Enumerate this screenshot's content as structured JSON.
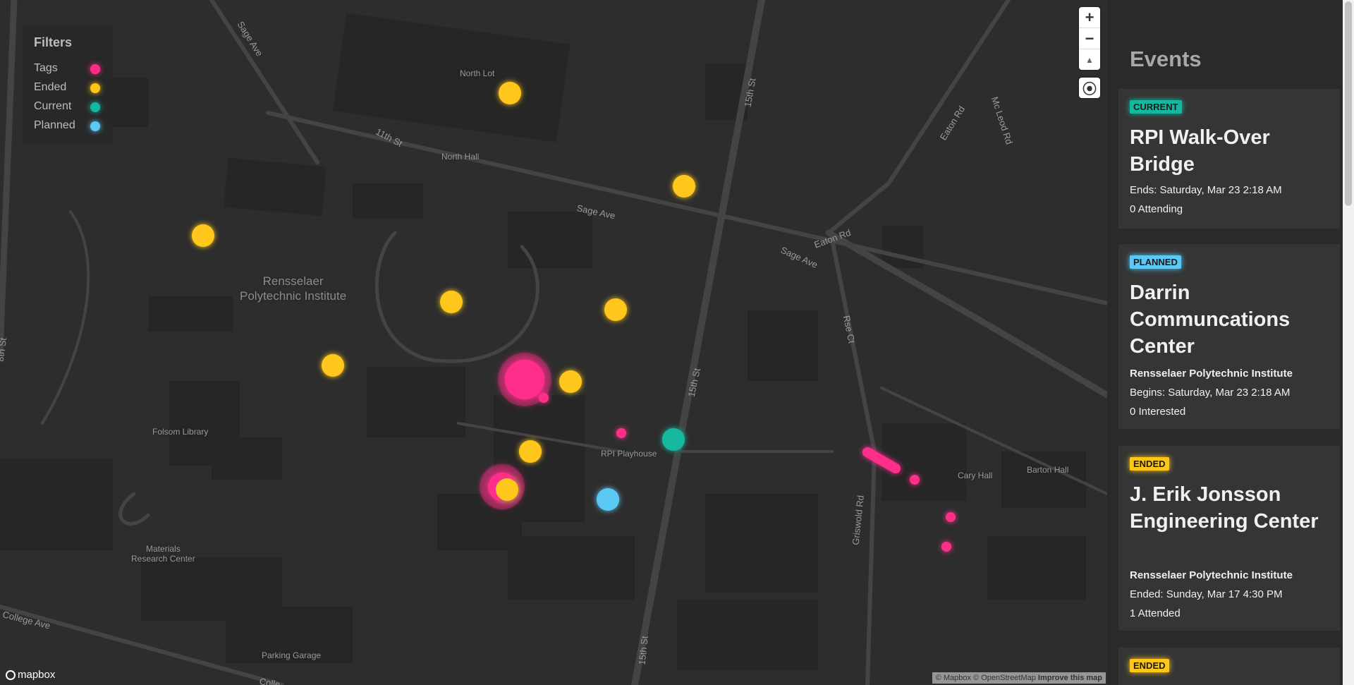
{
  "map": {
    "place_labels": [
      "North Lot",
      "North Hall",
      "Rensselaer\nPolytechnic Institute",
      "Folsom Library",
      "RPI Playhouse",
      "Materials\nResearch Center",
      "Parking Garage",
      "Cary Hall",
      "Barton Hall"
    ],
    "road_labels": [
      "Sage Ave",
      "11th St",
      "15th St",
      "Sage Ave",
      "Eaton Rd",
      "Sage Ave",
      "Eaton Rd",
      "Mc Leod Rd",
      "Rse Ct",
      "15th St",
      "Griswold Rd",
      "15th St",
      "College Ave",
      "8th St",
      "Colle"
    ],
    "attribution": "© Mapbox © OpenStreetMap",
    "improve_link": "Improve this map",
    "logo": "mapbox",
    "controls": {
      "zoom_in": "+",
      "zoom_out": "−",
      "compass": "▲",
      "geolocate": "⦿"
    }
  },
  "filters": {
    "title": "Filters",
    "items": [
      {
        "label": "Tags",
        "color": "#ff2d8a"
      },
      {
        "label": "Ended",
        "color": "#ffc61a"
      },
      {
        "label": "Current",
        "color": "#14b8a0"
      },
      {
        "label": "Planned",
        "color": "#5cc8f5"
      }
    ]
  },
  "sidebar": {
    "title": "Events",
    "events": [
      {
        "status": "CURRENT",
        "status_color": "#14b8a0",
        "name": "RPI Walk-Over Bridge",
        "location": "",
        "line1": "Ends: Saturday, Mar 23 2:18 AM",
        "line2": "0 Attending"
      },
      {
        "status": "PLANNED",
        "status_color": "#5cc8f5",
        "name": "Darrin Communcations Center",
        "location": "Rensselaer Polytechnic Institute",
        "line1": "Begins: Saturday, Mar 23 2:18 AM",
        "line2": "0 Interested"
      },
      {
        "status": "ENDED",
        "status_color": "#ffc61a",
        "name": "J. Erik Jonsson Engineering Center",
        "location": "Rensselaer Polytechnic Institute",
        "line1": "Ended: Sunday, Mar 17 4:30 PM",
        "line2": "1 Attended"
      },
      {
        "status": "ENDED",
        "status_color": "#ffc61a",
        "name": "",
        "location": "",
        "line1": "",
        "line2": ""
      }
    ]
  }
}
